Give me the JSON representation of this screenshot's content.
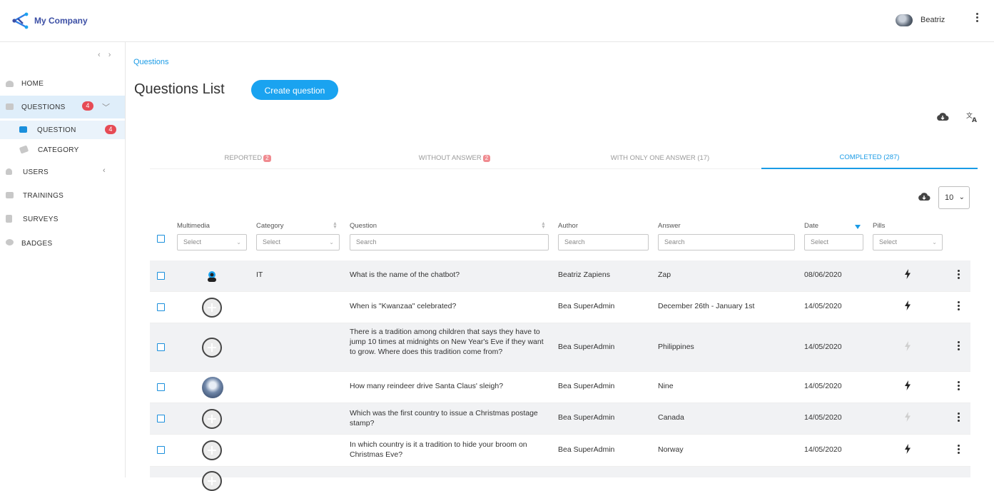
{
  "app": {
    "brand": "My Company",
    "user": "Beatriz"
  },
  "sidebar": {
    "items": [
      {
        "label": "HOME",
        "icon": "home-icon"
      },
      {
        "label": "QUESTIONS",
        "icon": "questions-icon",
        "badge": "4"
      },
      {
        "label": "QUESTION",
        "icon": "question-icon",
        "badge": "4"
      },
      {
        "label": "CATEGORY",
        "icon": "category-icon"
      },
      {
        "label": "USERS",
        "icon": "users-icon"
      },
      {
        "label": "TRAININGS",
        "icon": "trainings-icon"
      },
      {
        "label": "SURVEYS",
        "icon": "surveys-icon"
      },
      {
        "label": "BADGES",
        "icon": "badges-icon"
      }
    ]
  },
  "page": {
    "breadcrumb": "Questions",
    "title": "Questions List",
    "create_label": "Create question"
  },
  "tabs": [
    {
      "label": "REPORTED",
      "badge": "2"
    },
    {
      "label": "WITHOUT ANSWER",
      "badge": "2"
    },
    {
      "label": "WITH ONLY ONE ANSWER (17)"
    },
    {
      "label": "COMPLETED (287)",
      "active": true
    }
  ],
  "page_size": "10",
  "table": {
    "headers": [
      "Multimedia",
      "Category",
      "Question",
      "Author",
      "Answer",
      "Date",
      "Pills"
    ],
    "filters": {
      "multimedia": "Select",
      "category": "Select",
      "question": "Search",
      "author": "Search",
      "answer": "Search",
      "date": "Select",
      "pills": "Select"
    },
    "rows": [
      {
        "media": "chatbot",
        "category": "IT",
        "question": "What is the name of the chatbot?",
        "author": "Beatriz Zapiens",
        "answer": "Zap",
        "date": "08/06/2020",
        "pill": "active"
      },
      {
        "media": "empty",
        "category": "",
        "question": "When is \"Kwanzaa\" celebrated?",
        "author": "Bea SuperAdmin",
        "answer": "December 26th - January 1st",
        "date": "14/05/2020",
        "pill": "active"
      },
      {
        "media": "empty",
        "category": "",
        "question": "There is a tradition among children that says they have to jump 10 times at midnights on New Year's Eve if they want to grow. Where does this tradition come from?",
        "author": "Bea SuperAdmin",
        "answer": "Philippines",
        "date": "14/05/2020",
        "pill": "inactive"
      },
      {
        "media": "photo",
        "category": "",
        "question": "How many reindeer drive Santa Claus' sleigh?",
        "author": "Bea SuperAdmin",
        "answer": "Nine",
        "date": "14/05/2020",
        "pill": "active"
      },
      {
        "media": "empty",
        "category": "",
        "question": "Which was the first country to issue a Christmas postage stamp?",
        "author": "Bea SuperAdmin",
        "answer": "Canada",
        "date": "14/05/2020",
        "pill": "inactive"
      },
      {
        "media": "empty",
        "category": "",
        "question": "In which country is it a tradition to hide your broom on Christmas Eve?",
        "author": "Bea SuperAdmin",
        "answer": "Norway",
        "date": "14/05/2020",
        "pill": "active"
      }
    ]
  },
  "colors": {
    "accent": "#1aa3f0",
    "badge": "#e64b55",
    "brand": "#3c4fa5"
  }
}
